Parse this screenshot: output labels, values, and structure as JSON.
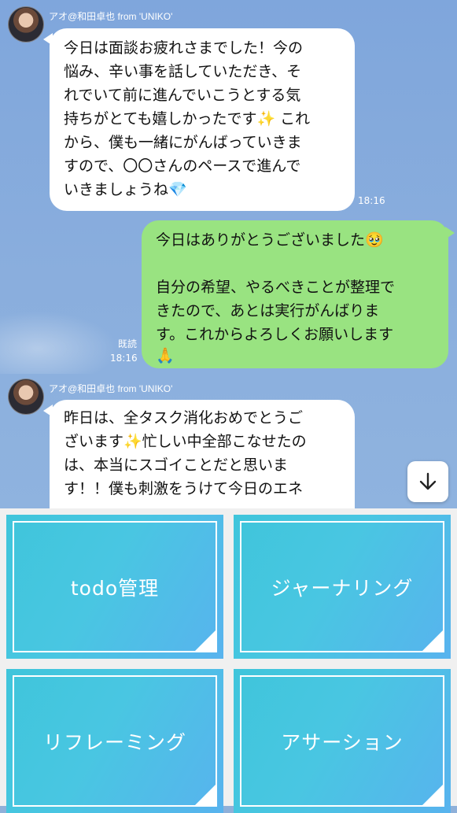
{
  "messages": [
    {
      "sender": "アオ@和田卓也 from 'UNIKO'",
      "lines": [
        "今日は面談お疲れさまでした！今の",
        "悩み、辛い事を話していただき、そ",
        "れでいて前に進んでいこうとする気",
        "持ちがとても嬉しかったです✨ これ",
        "から、僕も一緒にがんばっていきま",
        "すので、〇〇さんのペースで進んで",
        "いきましょうね💎"
      ],
      "time": "18:16"
    },
    {
      "lines": [
        "今日はありがとうございました🥹",
        "",
        "自分の希望、やるべきことが整理で",
        "きたので、あとは実行がんばりま",
        "す。これからよろしくお願いします",
        "🙏"
      ],
      "read": "既読",
      "time": "18:16"
    },
    {
      "sender": "アオ@和田卓也 from 'UNIKO'",
      "lines": [
        "昨日は、全タスク消化おめでとうご",
        "ざいます✨忙しい中全部こなせたの",
        "は、本当にスゴイことだと思いま",
        "す！！僕も刺激をうけて今日のエネ"
      ]
    }
  ],
  "scroll_button_icon": "arrow-down-icon",
  "menu": {
    "items": [
      {
        "label": "todo管理"
      },
      {
        "label": "ジャーナリング"
      },
      {
        "label": "リフレーミング"
      },
      {
        "label": "アサーション"
      }
    ]
  },
  "colors": {
    "chat_background": "#8aaedd",
    "outgoing_bubble": "#99e381",
    "incoming_bubble": "#ffffff",
    "menu_tile": "#49c6e2"
  }
}
